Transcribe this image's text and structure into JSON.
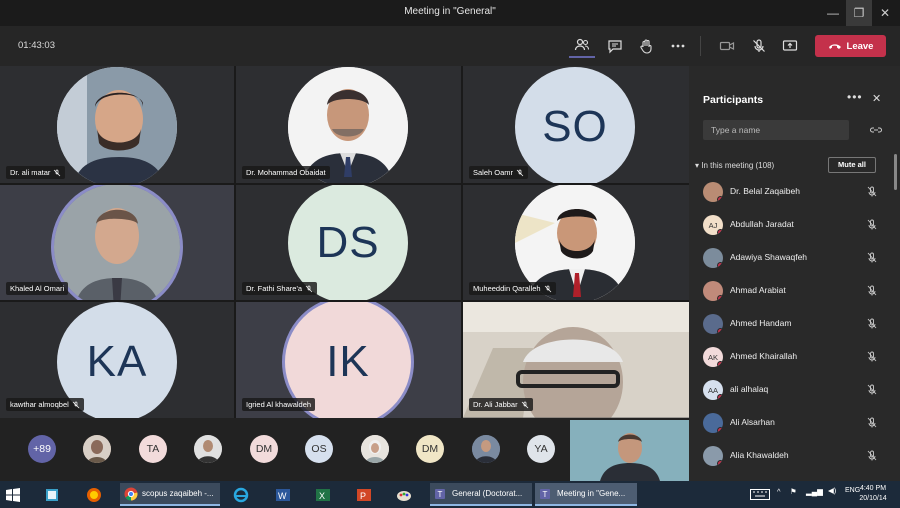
{
  "window": {
    "title": "Meeting in \"General\"",
    "minimize": "—",
    "restore": "❐",
    "close": "✕"
  },
  "toolbar": {
    "timer": "01:43:03",
    "leave_label": "Leave"
  },
  "tiles": [
    {
      "name": "Dr. ali matar",
      "kind": "photo",
      "bg": "#3a3b3e"
    },
    {
      "name": "Dr. Mohammad Obaidat",
      "kind": "photo",
      "bg": "#3a3b3e"
    },
    {
      "name": "Saleh Oamr",
      "kind": "initials",
      "initials": "SO",
      "color": "#d3dde9"
    },
    {
      "name": "Khaled Al Omari",
      "kind": "photo",
      "bg": "#3a3b3e"
    },
    {
      "name": "Dr. Fathi Share'a",
      "kind": "initials",
      "initials": "DS",
      "color": "#dbeadf"
    },
    {
      "name": "Muheeddin Qaralleh",
      "kind": "photo",
      "bg": "#3a3b3e"
    },
    {
      "name": "kawthar almoqbel",
      "kind": "initials",
      "initials": "KA",
      "color": "#d3dde9"
    },
    {
      "name": "Igried Al khawaldeh",
      "kind": "initials",
      "initials": "IK",
      "color": "#f1d9d9"
    },
    {
      "name": "Dr. Ali Jabbar",
      "kind": "video",
      "bg": "#cfc8bd"
    }
  ],
  "strip": [
    {
      "label": "+89",
      "color": "#6264a7",
      "text_color": "#ffffff"
    },
    {
      "label": "",
      "color": "#9a7a6a"
    },
    {
      "label": "TA",
      "color": "#f2dbdb"
    },
    {
      "label": "",
      "color": "#8a8a8a"
    },
    {
      "label": "DM",
      "color": "#f2dbdb"
    },
    {
      "label": "OS",
      "color": "#d6e0ee"
    },
    {
      "label": "",
      "color": "#d8d0c8"
    },
    {
      "label": "DM",
      "color": "#f0e6c6"
    },
    {
      "label": "",
      "color": "#5a6f8a"
    },
    {
      "label": "YA",
      "color": "#dfe4ea"
    }
  ],
  "participants_panel": {
    "title": "Participants",
    "search_placeholder": "Type a name",
    "in_meeting_label": "In this meeting (108)",
    "mute_all_label": "Mute all",
    "people": [
      {
        "name": "Dr. Belal Zaqaibeh",
        "initials": "",
        "color": "#b98c74"
      },
      {
        "name": "Abdullah Jaradat",
        "initials": "AJ",
        "color": "#f2dfc9"
      },
      {
        "name": "Adawiya Shawaqfeh",
        "initials": "",
        "color": "#7c8c9c"
      },
      {
        "name": "Ahmad Arabiat",
        "initials": "",
        "color": "#c08a7a"
      },
      {
        "name": "Ahmed Handam",
        "initials": "",
        "color": "#5a6b8c"
      },
      {
        "name": "Ahmed Khairallah",
        "initials": "AK",
        "color": "#f2dada"
      },
      {
        "name": "ali alhalaq",
        "initials": "AA",
        "color": "#d6e0ee"
      },
      {
        "name": "Ali Alsarhan",
        "initials": "",
        "color": "#4a6a9a"
      },
      {
        "name": "Alia Khawaldeh",
        "initials": "",
        "color": "#8a9aaa"
      }
    ]
  },
  "taskbar": {
    "items": [
      "scopus zaqaibeh -...",
      "General (Doctorat...",
      "Meeting in \"Gene..."
    ],
    "lang": "ENG",
    "time": "4:40 PM",
    "date": "20/10/14"
  },
  "colors": {
    "accent": "#6264a7",
    "leave": "#c4314b",
    "taskbar": "#1c2a3a"
  }
}
